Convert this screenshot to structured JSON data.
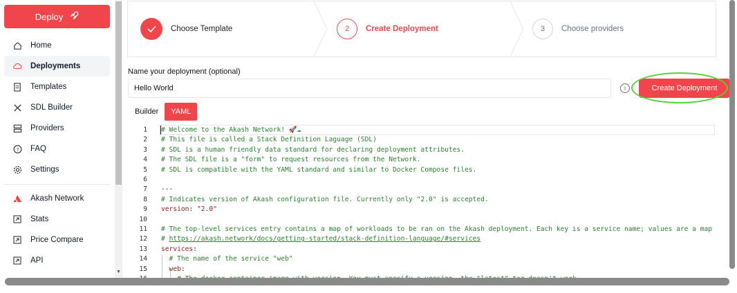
{
  "sidebar": {
    "deploy_label": "Deploy",
    "items": [
      {
        "label": "Home",
        "icon": "home-icon"
      },
      {
        "label": "Deployments",
        "icon": "cloud-icon",
        "active": true
      },
      {
        "label": "Templates",
        "icon": "templates-icon"
      },
      {
        "label": "SDL Builder",
        "icon": "tools-icon"
      },
      {
        "label": "Providers",
        "icon": "server-icon"
      },
      {
        "label": "FAQ",
        "icon": "question-icon"
      },
      {
        "label": "Settings",
        "icon": "gear-icon"
      }
    ],
    "external_items": [
      {
        "label": "Akash Network",
        "icon": "akash-logo-icon"
      },
      {
        "label": "Stats",
        "icon": "external-link-icon"
      },
      {
        "label": "Price Compare",
        "icon": "external-link-icon"
      },
      {
        "label": "API",
        "icon": "external-link-icon"
      }
    ]
  },
  "stepper": {
    "steps": [
      {
        "number": "",
        "label": "Choose Template",
        "state": "completed"
      },
      {
        "number": "2",
        "label": "Create Deployment",
        "state": "active"
      },
      {
        "number": "3",
        "label": "Choose providers",
        "state": "pending"
      }
    ]
  },
  "form": {
    "name_label": "Name your deployment (optional)",
    "name_value": "Hello World",
    "info_icon": "info-icon",
    "create_label": "Create Deployment"
  },
  "tabs": [
    {
      "label": "Builder",
      "active": false
    },
    {
      "label": "YAML",
      "active": true
    }
  ],
  "editor": {
    "lines": [
      {
        "n": "1",
        "text": "# Welcome to the Akash Network! 🚀☁",
        "kind": "cmt"
      },
      {
        "n": "2",
        "text": "# This file is called a Stack Definition Laguage (SDL)",
        "kind": "cmt"
      },
      {
        "n": "3",
        "text": "# SDL is a human friendly data standard for declaring deployment attributes.",
        "kind": "cmt"
      },
      {
        "n": "4",
        "text": "# The SDL file is a \"form\" to request resources from the Network.",
        "kind": "cmt"
      },
      {
        "n": "5",
        "text": "# SDL is compatible with the YAML standard and similar to Docker Compose files.",
        "kind": "cmt"
      },
      {
        "n": "6",
        "text": "",
        "kind": "plain"
      },
      {
        "n": "7",
        "text": "---",
        "kind": "plain"
      },
      {
        "n": "8",
        "text": "# Indicates version of Akash configuration file. Currently only \"2.0\" is accepted.",
        "kind": "cmt"
      },
      {
        "n": "9",
        "key": "version",
        "value": "\"2.0\"",
        "kind": "kv"
      },
      {
        "n": "10",
        "text": "",
        "kind": "plain"
      },
      {
        "n": "11",
        "text": "# The top-level services entry contains a map of workloads to be ran on the Akash deployment. Each key is a service name; values are a map c",
        "kind": "cmt"
      },
      {
        "n": "12",
        "prefix": "# ",
        "url": "https://akash.network/docs/getting-started/stack-definition-language/#services",
        "kind": "url"
      },
      {
        "n": "13",
        "key": "services",
        "value": "",
        "kind": "kv"
      },
      {
        "n": "14",
        "text": "  # The name of the service \"web\"",
        "kind": "cmt"
      },
      {
        "n": "15",
        "key": "  web",
        "value": "",
        "kind": "kv"
      },
      {
        "n": "16",
        "text": "    # The docker container image with version. You must specify a version, the \"latest\" tag doesn't work.",
        "kind": "cmt"
      }
    ]
  }
}
